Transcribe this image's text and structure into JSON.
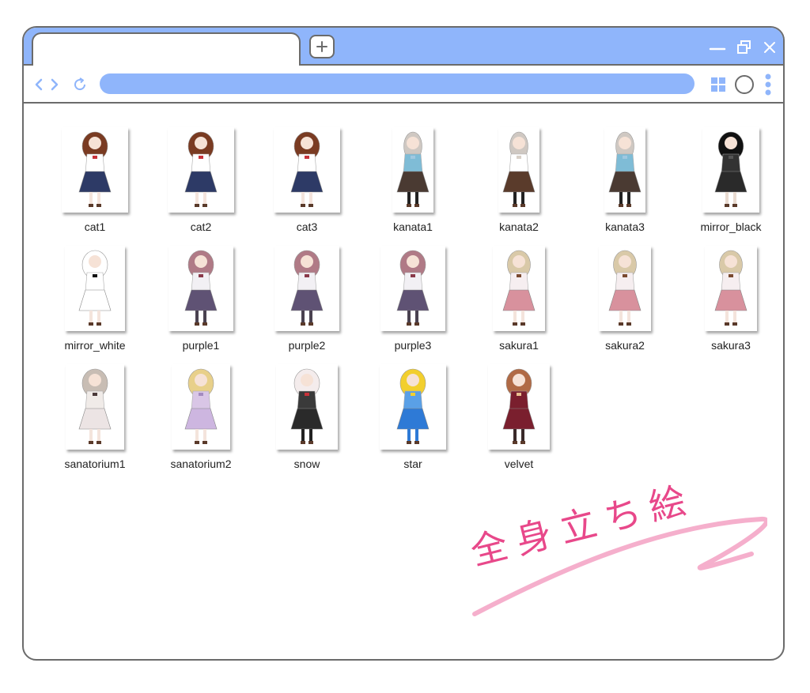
{
  "colors": {
    "accent": "#8fb5fb",
    "border": "#6b6b6b",
    "handwriting": "#e8488a",
    "swoosh": "#f4a6c6"
  },
  "toolbar": {
    "new_tab_icon": "plus-icon",
    "back_icon": "chevron-left-icon",
    "forward_icon": "chevron-right-icon",
    "reload_icon": "reload-icon"
  },
  "files": [
    {
      "name": "cat1",
      "palette": {
        "hair": "#7a3b22",
        "top": "#ffffff",
        "bottom": "#2d3a66",
        "legs": "#f4e4dc",
        "accent": "#c8323a"
      }
    },
    {
      "name": "cat2",
      "palette": {
        "hair": "#7a3b22",
        "top": "#ffffff",
        "bottom": "#2d3a66",
        "legs": "#f4e4dc",
        "accent": "#c8323a"
      }
    },
    {
      "name": "cat3",
      "palette": {
        "hair": "#7a3b22",
        "top": "#ffffff",
        "bottom": "#2d3a66",
        "legs": "#f4e4dc",
        "accent": "#c8323a"
      }
    },
    {
      "name": "kanata1",
      "palette": {
        "hair": "#cfc8c2",
        "top": "#7fbcd6",
        "bottom": "#4a3a32",
        "legs": "#222222",
        "accent": "#a0c8e0"
      }
    },
    {
      "name": "kanata2",
      "palette": {
        "hair": "#cfc8c2",
        "top": "#ffffff",
        "bottom": "#5a3b2b",
        "legs": "#222222",
        "accent": "#d8d0c8"
      }
    },
    {
      "name": "kanata3",
      "palette": {
        "hair": "#cfc8c2",
        "top": "#7fbcd6",
        "bottom": "#4a3a32",
        "legs": "#222222",
        "accent": "#a0c8e0"
      }
    },
    {
      "name": "mirror_black",
      "palette": {
        "hair": "#111111",
        "top": "#333333",
        "bottom": "#2a2a2a",
        "legs": "#e8dad0",
        "accent": "#555555"
      }
    },
    {
      "name": "mirror_white",
      "palette": {
        "hair": "#ffffff",
        "top": "#ffffff",
        "bottom": "#ffffff",
        "legs": "#f4e4dc",
        "accent": "#111111"
      }
    },
    {
      "name": "purple1",
      "palette": {
        "hair": "#b07a86",
        "top": "#f2f0f4",
        "bottom": "#5f5274",
        "legs": "#4a4250",
        "accent": "#8a3a4a"
      }
    },
    {
      "name": "purple2",
      "palette": {
        "hair": "#b07a86",
        "top": "#f2f0f4",
        "bottom": "#5f5274",
        "legs": "#4a4250",
        "accent": "#8a3a4a"
      }
    },
    {
      "name": "purple3",
      "palette": {
        "hair": "#b07a86",
        "top": "#f2f0f4",
        "bottom": "#5f5274",
        "legs": "#4a4250",
        "accent": "#8a3a4a"
      }
    },
    {
      "name": "sakura1",
      "palette": {
        "hair": "#d9c9a8",
        "top": "#f6eef0",
        "bottom": "#d8919d",
        "legs": "#f4e4dc",
        "accent": "#7a4a30"
      }
    },
    {
      "name": "sakura2",
      "palette": {
        "hair": "#d9c9a8",
        "top": "#f6eef0",
        "bottom": "#d8919d",
        "legs": "#f4e4dc",
        "accent": "#7a4a30"
      }
    },
    {
      "name": "sakura3",
      "palette": {
        "hair": "#d9c9a8",
        "top": "#f6eef0",
        "bottom": "#d8919d",
        "legs": "#f4e4dc",
        "accent": "#7a4a30"
      }
    },
    {
      "name": "sanatorium1",
      "palette": {
        "hair": "#c8bdb4",
        "top": "#f0ebe8",
        "bottom": "#ece4e4",
        "legs": "#f4e4dc",
        "accent": "#4a3a3a"
      }
    },
    {
      "name": "sanatorium2",
      "palette": {
        "hair": "#e8d08a",
        "top": "#d9c6e6",
        "bottom": "#cdb6e0",
        "legs": "#f4e4dc",
        "accent": "#a38bc0"
      }
    },
    {
      "name": "snow",
      "palette": {
        "hair": "#f4ecec",
        "top": "#3a3a3a",
        "bottom": "#2a2a2a",
        "legs": "#222222",
        "accent": "#c8323a"
      }
    },
    {
      "name": "star",
      "palette": {
        "hair": "#f2cf2e",
        "top": "#5aa0e6",
        "bottom": "#2e7ad6",
        "legs": "#2e7ad6",
        "accent": "#f2cf2e"
      }
    },
    {
      "name": "velvet",
      "palette": {
        "hair": "#b06a45",
        "top": "#7a1f2e",
        "bottom": "#7a1f2e",
        "legs": "#3a2a2a",
        "accent": "#e8c090"
      }
    }
  ],
  "handwriting": {
    "text": "全身立ち絵"
  }
}
